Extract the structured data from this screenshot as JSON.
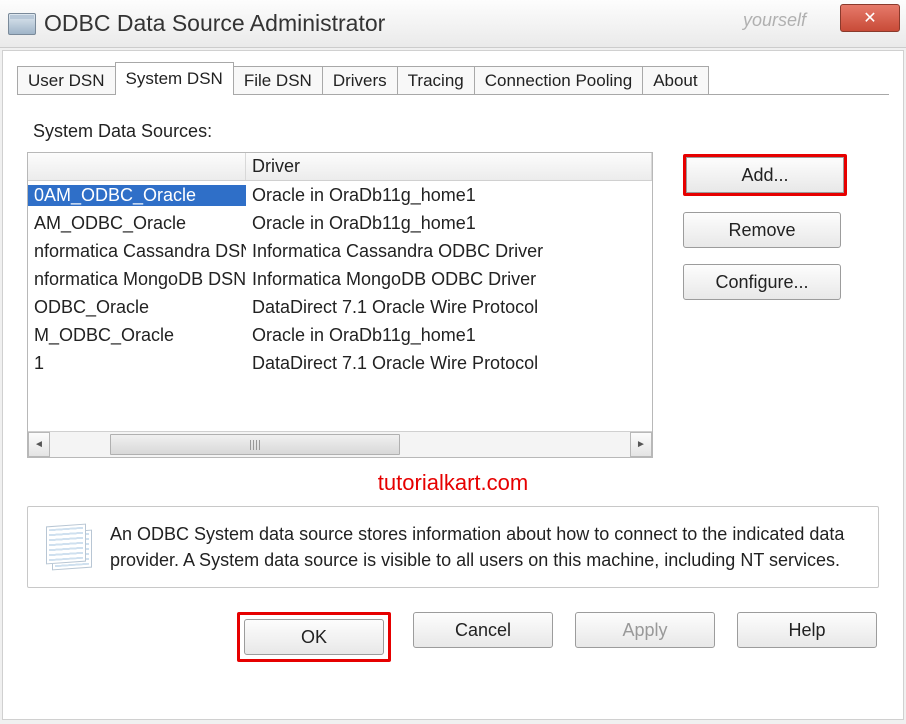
{
  "window": {
    "title": "ODBC Data Source Administrator",
    "watermark_bg": "yourself",
    "close_icon": "✕"
  },
  "tabs": [
    {
      "label": "User DSN"
    },
    {
      "label": "System DSN"
    },
    {
      "label": "File DSN"
    },
    {
      "label": "Drivers"
    },
    {
      "label": "Tracing"
    },
    {
      "label": "Connection Pooling"
    },
    {
      "label": "About"
    }
  ],
  "active_tab": 1,
  "section_label": "System Data Sources:",
  "columns": {
    "name": "",
    "driver": "Driver"
  },
  "rows": [
    {
      "name": "0AM_ODBC_Oracle",
      "driver": "Oracle in OraDb11g_home1",
      "selected": true
    },
    {
      "name": "AM_ODBC_Oracle",
      "driver": "Oracle in OraDb11g_home1"
    },
    {
      "name": "nformatica Cassandra DSN",
      "driver": "Informatica Cassandra ODBC Driver"
    },
    {
      "name": "nformatica MongoDB DSN",
      "driver": "Informatica MongoDB ODBC Driver"
    },
    {
      "name": "ODBC_Oracle",
      "driver": "DataDirect 7.1 Oracle Wire Protocol"
    },
    {
      "name": "M_ODBC_Oracle",
      "driver": "Oracle in OraDb11g_home1"
    },
    {
      "name": "1",
      "driver": "DataDirect 7.1 Oracle Wire Protocol"
    }
  ],
  "side_buttons": {
    "add": "Add...",
    "remove": "Remove",
    "configure": "Configure..."
  },
  "attribution": "tutorialkart.com",
  "info_text": "An ODBC System data source stores information about how to connect to the indicated data provider.   A System data source is visible to all users on this machine, including NT services.",
  "dialog_buttons": {
    "ok": "OK",
    "cancel": "Cancel",
    "apply": "Apply",
    "help": "Help"
  },
  "scroll": {
    "left": "◄",
    "right": "►"
  }
}
